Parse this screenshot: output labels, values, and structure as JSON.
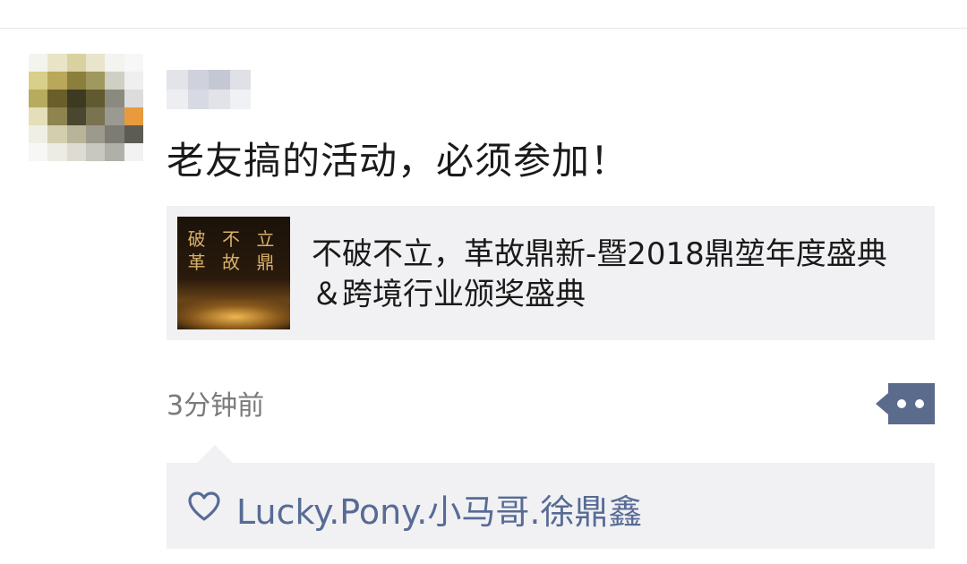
{
  "post": {
    "text": "老友搞的活动，必须参加！",
    "timestamp": "3分钟前"
  },
  "share": {
    "thumbnail_title_top": "破 不 立",
    "thumbnail_title_bottom": "革 故 鼎",
    "title": "不破不立，革故鼎新-暨2018鼎堃年度盛典＆跨境行业颁奖盛典"
  },
  "likes": {
    "names": "Lucky.Pony.小马哥.徐鼎鑫"
  },
  "icons": {
    "like": "heart-outline-icon",
    "actions": "comment-more-icon"
  },
  "colors": {
    "link_blue": "#576b95",
    "panel_bg": "#f1f1f3",
    "action_button": "#5a6b8c"
  }
}
